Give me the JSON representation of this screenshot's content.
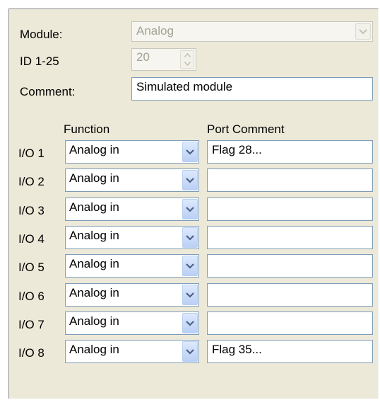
{
  "module": {
    "label": "Module:",
    "value": "Analog"
  },
  "id": {
    "label": "ID  1-25",
    "value": "20"
  },
  "comment": {
    "label": "Comment:",
    "value": "Simulated module"
  },
  "headers": {
    "function": "Function",
    "port_comment": "Port Comment"
  },
  "rows": [
    {
      "label": "I/O 1",
      "function": "Analog in",
      "port_comment": "Flag 28..."
    },
    {
      "label": "I/O 2",
      "function": "Analog in",
      "port_comment": ""
    },
    {
      "label": "I/O 3",
      "function": "Analog in",
      "port_comment": ""
    },
    {
      "label": "I/O 4",
      "function": "Analog in",
      "port_comment": ""
    },
    {
      "label": "I/O 5",
      "function": "Analog in",
      "port_comment": ""
    },
    {
      "label": "I/O 6",
      "function": "Analog in",
      "port_comment": ""
    },
    {
      "label": "I/O 7",
      "function": "Analog in",
      "port_comment": ""
    },
    {
      "label": "I/O 8",
      "function": "Analog in",
      "port_comment": "Flag 35..."
    }
  ],
  "icons": {
    "dropdown": "chevron-down-icon",
    "spinner_up": "arrow-up-icon",
    "spinner_down": "arrow-down-icon"
  }
}
